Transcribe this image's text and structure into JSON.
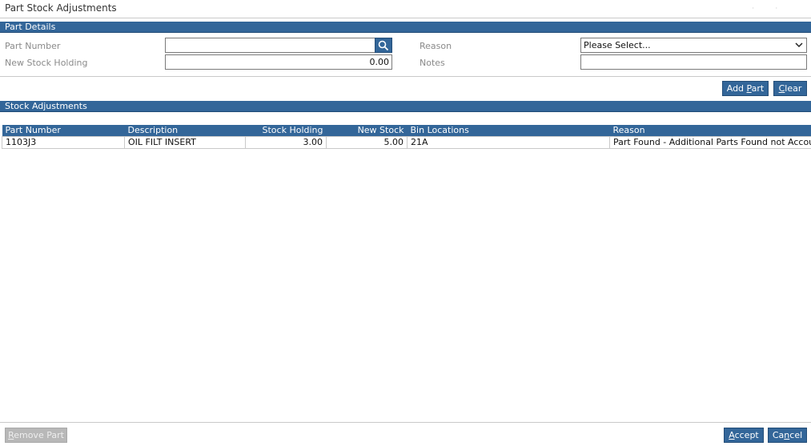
{
  "page": {
    "title": "Part Stock Adjustments"
  },
  "part_details": {
    "heading": "Part Details",
    "part_number_label": "Part Number",
    "part_number_value": "",
    "new_stock_holding_label": "New Stock Holding",
    "new_stock_holding_value": "0.00",
    "reason_label": "Reason",
    "reason_selected": "Please Select...",
    "notes_label": "Notes",
    "notes_value": "",
    "add_part_pre": "Add ",
    "add_part_accel": "P",
    "add_part_post": "art",
    "clear_pre": "",
    "clear_accel": "C",
    "clear_post": "lear"
  },
  "stock_adjustments": {
    "heading": "Stock Adjustments",
    "columns": [
      "Part Number",
      "Description",
      "Stock Holding",
      "New Stock",
      "Bin Locations",
      "Reason"
    ],
    "rows": [
      [
        "1103J3",
        "OIL FILT INSERT",
        "3.00",
        "5.00",
        "21A",
        "Part Found - Additional Parts Found not Accounted"
      ]
    ]
  },
  "footer": {
    "remove_part_pre": "",
    "remove_part_accel": "R",
    "remove_part_post": "emove Part",
    "accept_pre": "",
    "accept_accel": "A",
    "accept_post": "ccept",
    "cancel_pre": "Ca",
    "cancel_accel": "n",
    "cancel_post": "cel"
  },
  "colors": {
    "accent": "#336699",
    "border": "#7a7a7a",
    "disabled": "#b8b8b8"
  },
  "icons": {
    "search": "search-icon",
    "dropdown": "chevron-down-icon"
  }
}
